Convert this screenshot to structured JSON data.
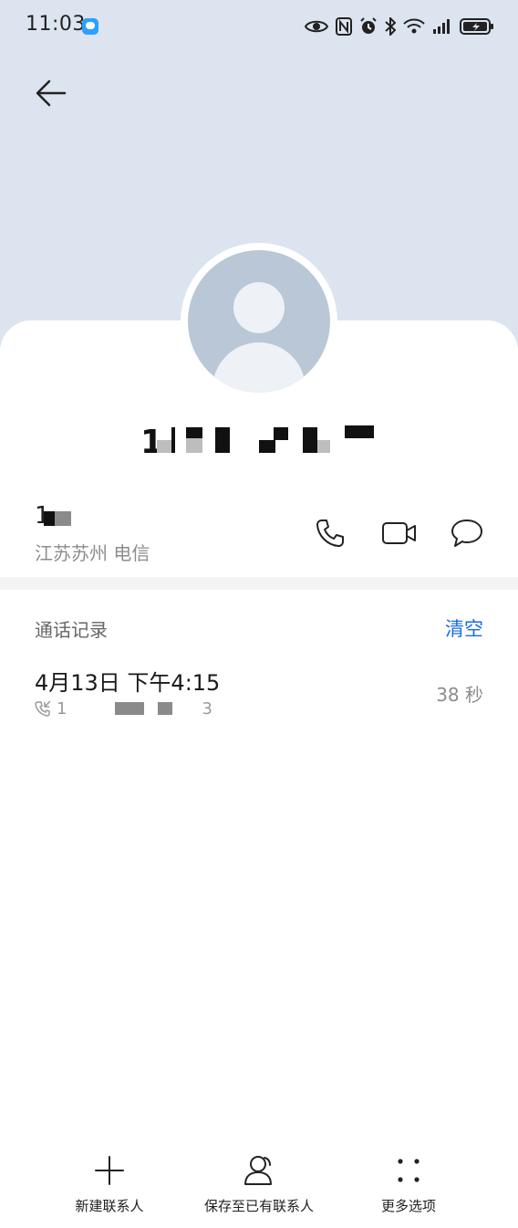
{
  "status_bar": {
    "time": "11:03"
  },
  "contact": {
    "name": "1",
    "phone_number": "1",
    "phone_number_tail": "8",
    "location": "江苏苏州 电信"
  },
  "call_log": {
    "title": "通话记录",
    "clear_label": "清空",
    "items": [
      {
        "datetime": "4月13日 下午4:15",
        "number": "1",
        "number_tail": "3",
        "duration": "38 秒"
      }
    ]
  },
  "bottom_bar": {
    "new_contact_label": "新建联系人",
    "save_existing_label": "保存至已有联系人",
    "more_label": "更多选项"
  },
  "icons": {
    "back": "back-arrow-icon",
    "call": "phone-icon",
    "video": "video-call-icon",
    "message": "message-icon",
    "new_contact": "plus-icon",
    "save_existing": "contact-person-icon",
    "more": "more-dots-icon"
  },
  "colors": {
    "header_bg": "#dbe4ef",
    "accent": "#1a6ee0",
    "avatar_bg": "#b9c7d6"
  }
}
